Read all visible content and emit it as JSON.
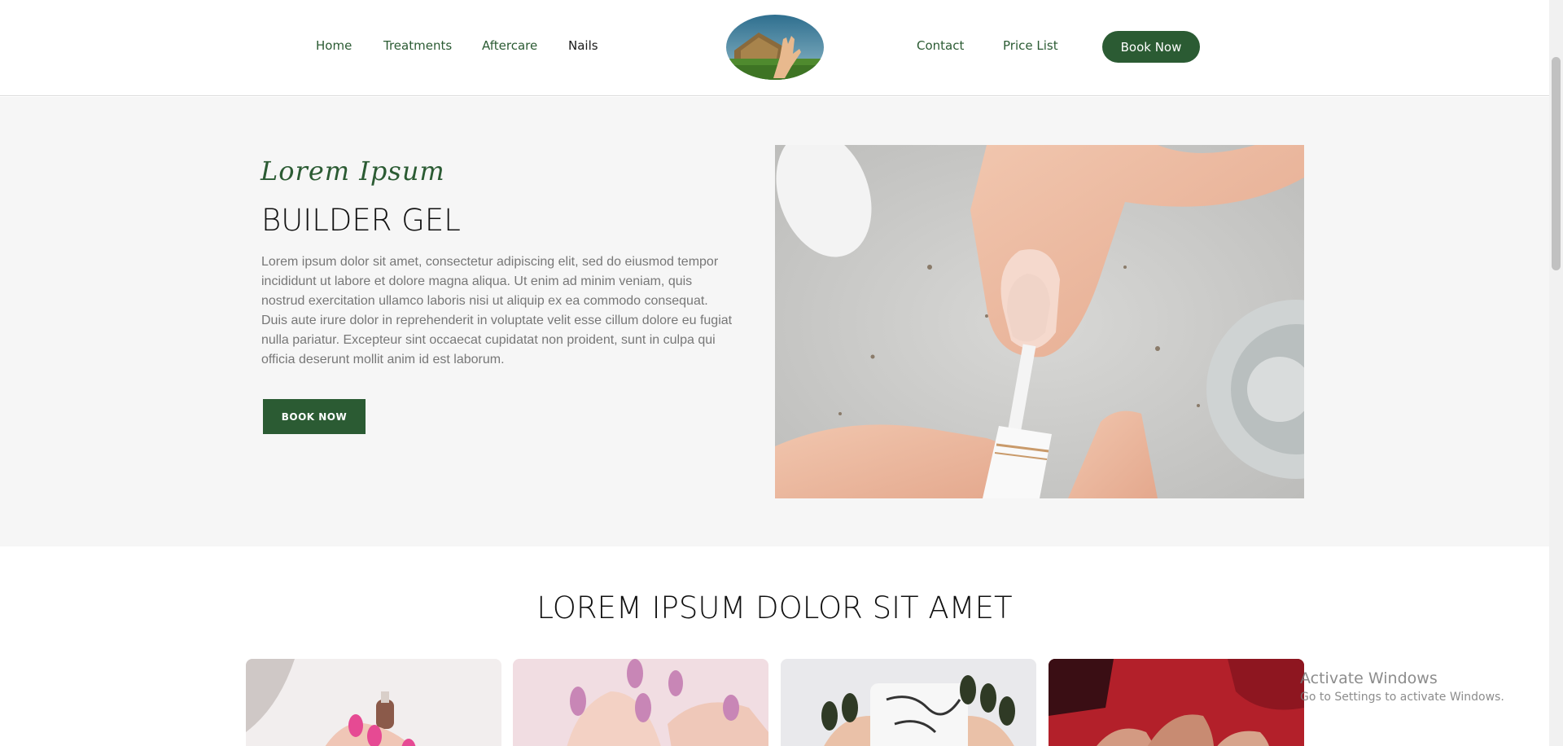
{
  "nav": {
    "left_links": [
      "Home",
      "Treatments",
      "Aftercare",
      "Nails"
    ],
    "right_links": [
      "Contact",
      "Price List"
    ],
    "active": "Nails",
    "book_now": "Book Now"
  },
  "hero": {
    "script_title": "Lorem Ipsum",
    "title": "BUILDER GEL",
    "body": "Lorem ipsum dolor sit amet, consectetur adipiscing elit, sed do eiusmod tempor incididunt ut labore et dolore magna aliqua. Ut enim ad minim veniam, quis nostrud exercitation ullamco laboris nisi ut aliquip ex ea commodo consequat. Duis aute irure dolor in reprehenderit in voluptate velit esse cillum dolore eu fugiat nulla pariatur. Excepteur sint occaecat cupidatat non proident, sunt in culpa qui officia deserunt mollit anim id est laborum.",
    "button": "BOOK NOW"
  },
  "section": {
    "title": "LOREM IPSUM DOLOR SIT AMET"
  },
  "watermark": {
    "title": "Activate Windows",
    "subtitle": "Go to Settings to activate Windows."
  },
  "colors": {
    "brand_green": "#2b5b33",
    "hero_bg": "#f6f6f6"
  }
}
